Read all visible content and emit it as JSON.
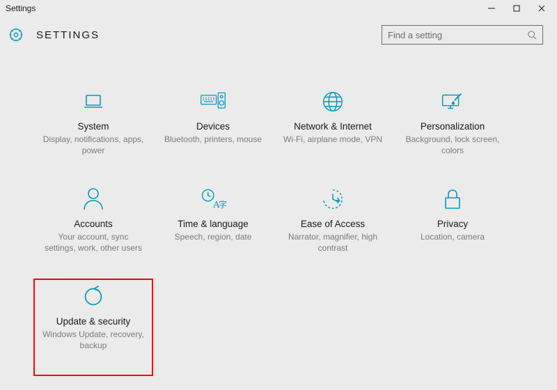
{
  "window": {
    "title": "Settings"
  },
  "header": {
    "label": "SETTINGS"
  },
  "search": {
    "placeholder": "Find a setting"
  },
  "colors": {
    "accent": "#0099bc"
  },
  "tiles": {
    "system": {
      "title": "System",
      "desc": "Display, notifications, apps, power"
    },
    "devices": {
      "title": "Devices",
      "desc": "Bluetooth, printers, mouse"
    },
    "network": {
      "title": "Network & Internet",
      "desc": "Wi-Fi, airplane mode, VPN"
    },
    "personalization": {
      "title": "Personalization",
      "desc": "Background, lock screen, colors"
    },
    "accounts": {
      "title": "Accounts",
      "desc": "Your account, sync settings, work, other users"
    },
    "time": {
      "title": "Time & language",
      "desc": "Speech, region, date"
    },
    "ease": {
      "title": "Ease of Access",
      "desc": "Narrator, magnifier, high contrast"
    },
    "privacy": {
      "title": "Privacy",
      "desc": "Location, camera"
    },
    "update": {
      "title": "Update & security",
      "desc": "Windows Update, recovery, backup"
    }
  }
}
